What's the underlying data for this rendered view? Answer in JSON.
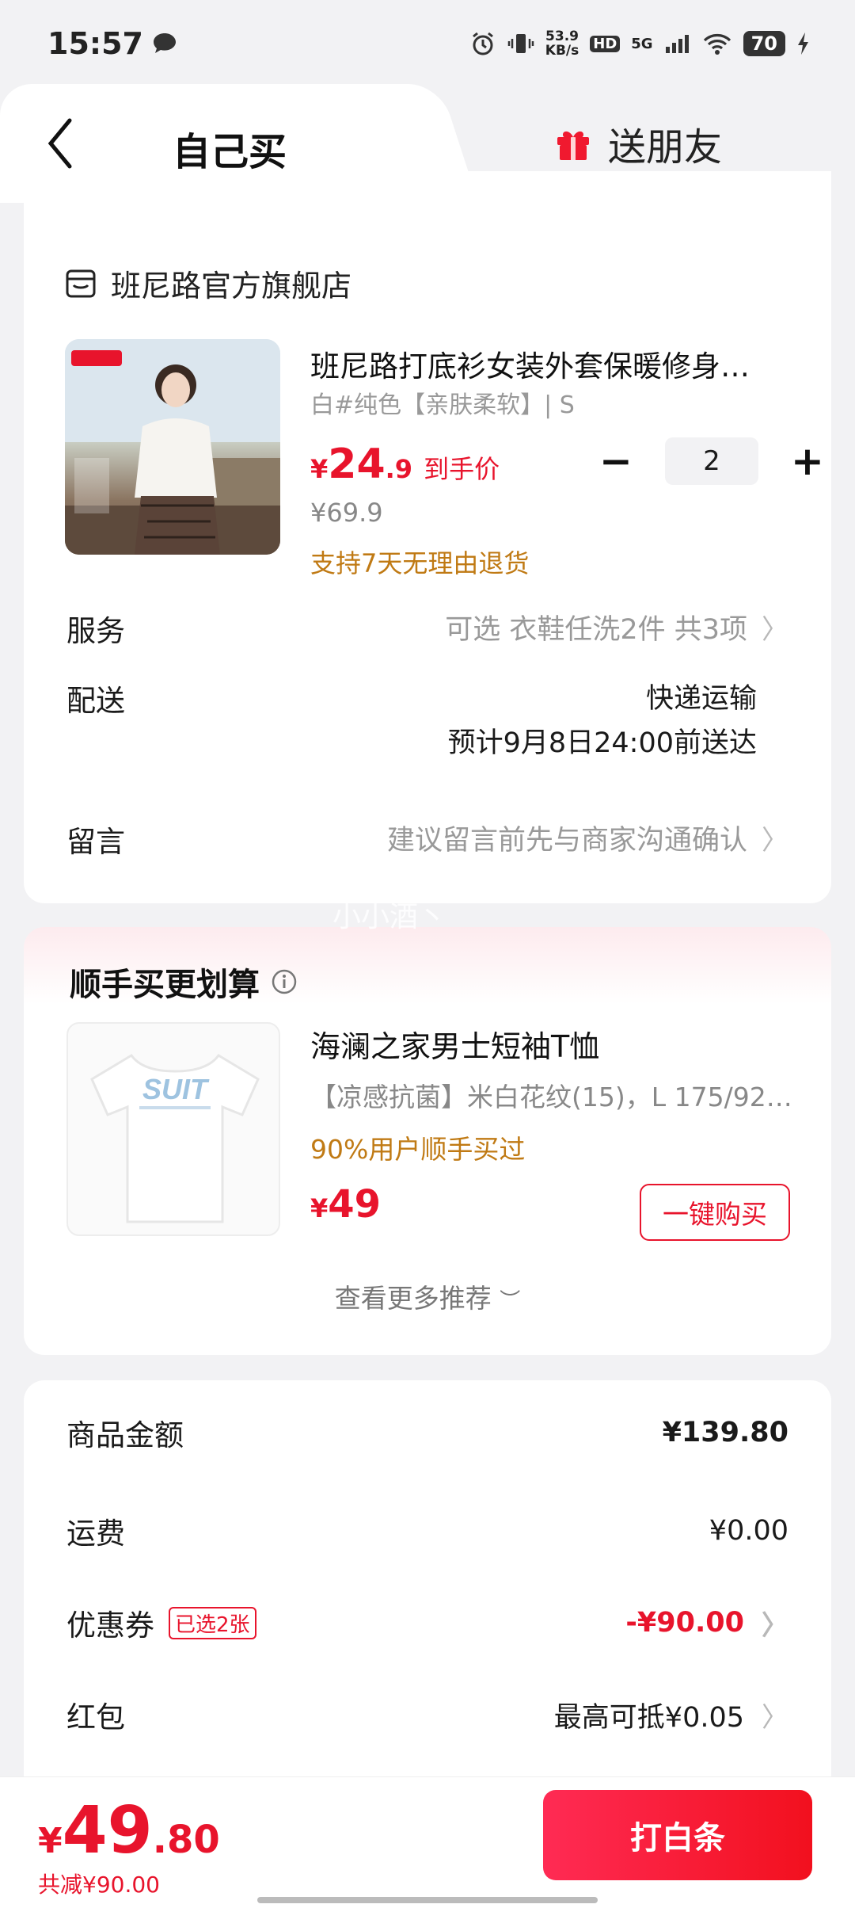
{
  "status_bar": {
    "time": "15:57",
    "net_speed_value": "53.9",
    "net_speed_unit": "KB/s",
    "hd": "HD",
    "signal": "5G",
    "battery": "70"
  },
  "tabs": {
    "self": "自己买",
    "gift": "送朋友"
  },
  "store": {
    "name": "班尼路官方旗舰店"
  },
  "product": {
    "title": "班尼路打底衫女装外套保暖修身…",
    "spec": "白#纯色【亲肤柔软】| S",
    "price_symbol": "¥",
    "price_int": "24",
    "price_dec": ".9",
    "price_tag": "到手价",
    "original_price": "¥69.9",
    "return_note": "支持7天无理由退货",
    "quantity": "2"
  },
  "rows": {
    "service_label": "服务",
    "service_value": "可选 衣鞋任洗2件 共3项",
    "delivery_label": "配送",
    "delivery_method": "快递运输",
    "delivery_eta": "预计9月8日24:00前送达",
    "message_label": "留言",
    "message_placeholder": "建议留言前先与商家沟通确认"
  },
  "watermark": "小小酒丶",
  "recommend": {
    "title": "顺手买更划算",
    "name": "海澜之家男士短袖T恤",
    "spec": "【凉感抗菌】米白花纹(15)，L 175/92…",
    "popularity": "90%用户顺手买过",
    "price_symbol": "¥",
    "price": "49",
    "buy_label": "一键购买",
    "more": "查看更多推荐",
    "shirt_print": "SUIT"
  },
  "summary": {
    "goods_label": "商品金额",
    "goods_value": "¥139.80",
    "shipping_label": "运费",
    "shipping_value": "¥0.00",
    "coupon_label": "优惠券",
    "coupon_tag": "已选2张",
    "coupon_value": "-¥90.00",
    "redpacket_label": "红包",
    "redpacket_value": "最高可抵¥0.05"
  },
  "bottom": {
    "total_symbol": "¥",
    "total_int": "49",
    "total_dec": ".80",
    "saved": "共减¥90.00",
    "pay_label": "打白条"
  },
  "colors": {
    "accent_red": "#e8142c",
    "note_orange": "#c07a14",
    "background": "#f2f2f4"
  }
}
